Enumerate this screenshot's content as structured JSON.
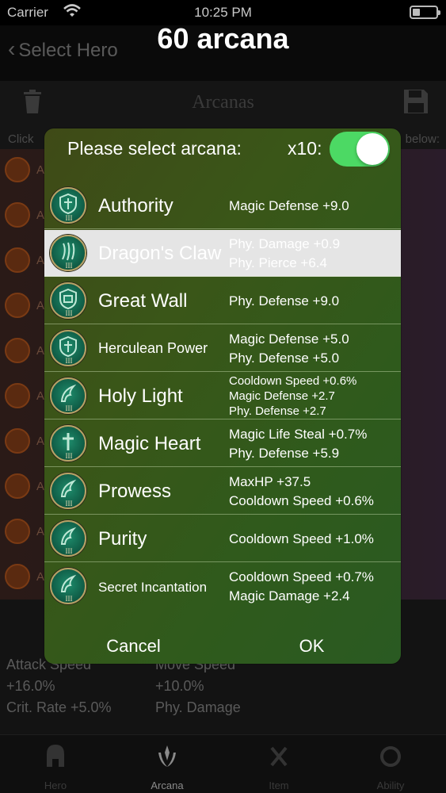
{
  "status_bar": {
    "carrier": "Carrier",
    "time": "10:25 PM"
  },
  "nav": {
    "back_label": "Select Hero",
    "title": "60 arcana"
  },
  "toolbar": {
    "title": "Arcanas"
  },
  "bg_header": {
    "left": "Click",
    "right": "below:"
  },
  "bg_list": {
    "row_prefix": "A"
  },
  "bg_stats": {
    "attack_speed_label": "Attack Speed",
    "attack_speed_value": "+16.0%",
    "move_speed_label": "Move Speed",
    "move_speed_value": "+10.0%",
    "crit_rate": "Crit. Rate +5.0%",
    "phy_damage_label": "Phy. Damage"
  },
  "tabs": [
    {
      "label": "Hero",
      "icon": "helmet-icon"
    },
    {
      "label": "Arcana",
      "icon": "arcana-laurel-icon"
    },
    {
      "label": "Item",
      "icon": "sword-icon"
    },
    {
      "label": "Ability",
      "icon": "ability-icon"
    }
  ],
  "modal": {
    "title": "Please select arcana:",
    "x10_label": "x10:",
    "x10_enabled": true,
    "cancel_label": "Cancel",
    "ok_label": "OK",
    "arcanas": [
      {
        "name": "Authority",
        "effects": [
          "Magic Defense +9.0"
        ],
        "icon": "shield-emblem-icon",
        "tier": "III",
        "selected": false
      },
      {
        "name": "Dragon's Claw",
        "effects": [
          "Phy. Damage +0.9",
          "Phy. Pierce +6.4"
        ],
        "icon": "claw-emblem-icon",
        "tier": "III",
        "selected": true
      },
      {
        "name": "Great Wall",
        "effects": [
          "Phy. Defense +9.0"
        ],
        "icon": "shield-emblem-icon",
        "tier": "III",
        "selected": false
      },
      {
        "name": "Herculean Power",
        "effects": [
          "Magic Defense +5.0",
          "Phy. Defense +5.0"
        ],
        "icon": "shield-emblem-icon",
        "tier": "III",
        "selected": false
      },
      {
        "name": "Holy Light",
        "effects": [
          "Cooldown Speed +0.6%",
          "Magic Defense +2.7",
          "Phy. Defense +2.7"
        ],
        "icon": "wing-emblem-icon",
        "tier": "III",
        "selected": false
      },
      {
        "name": "Magic Heart",
        "effects": [
          "Magic Life Steal +0.7%",
          "Phy. Defense +5.9"
        ],
        "icon": "cross-emblem-icon",
        "tier": "III",
        "selected": false
      },
      {
        "name": "Prowess",
        "effects": [
          "MaxHP +37.5",
          "Cooldown Speed +0.6%"
        ],
        "icon": "wing-emblem-icon",
        "tier": "III",
        "selected": false
      },
      {
        "name": "Purity",
        "effects": [
          "Cooldown Speed +1.0%"
        ],
        "icon": "wing-emblem-icon",
        "tier": "III",
        "selected": false
      },
      {
        "name": "Secret Incantation",
        "effects": [
          "Cooldown Speed +0.7%",
          "Magic Damage +2.4"
        ],
        "icon": "wing-emblem-icon",
        "tier": "III",
        "selected": false
      }
    ]
  }
}
